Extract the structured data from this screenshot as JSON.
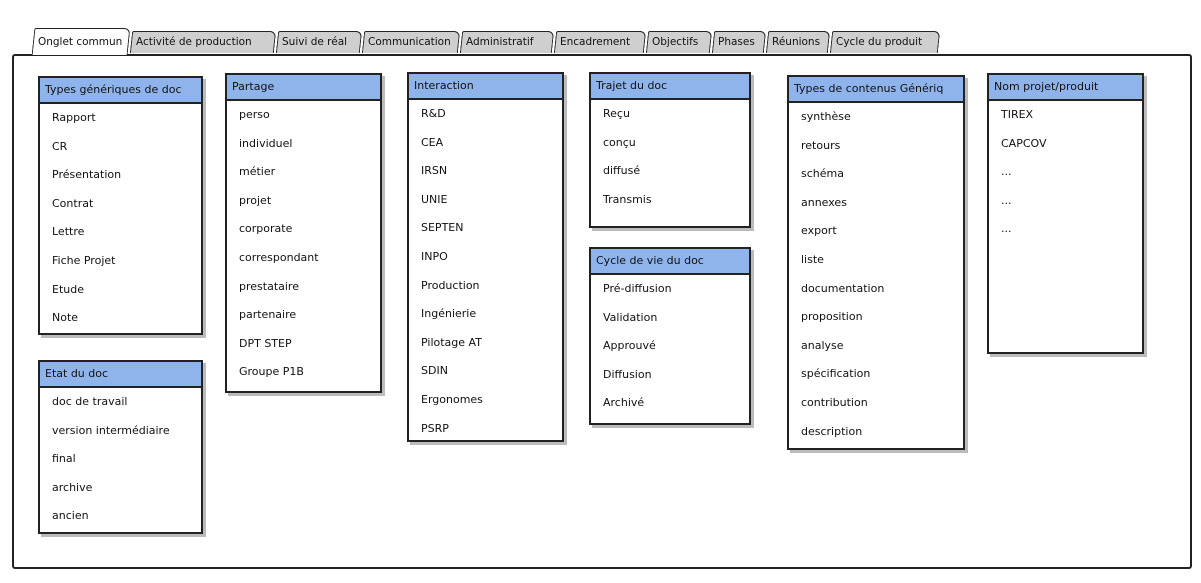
{
  "tabs": [
    {
      "label": "Onglet commun",
      "active": true
    },
    {
      "label": "Activité de production",
      "active": false
    },
    {
      "label": "Suivi de réal",
      "active": false
    },
    {
      "label": "Communication",
      "active": false
    },
    {
      "label": "Administratif",
      "active": false
    },
    {
      "label": "Encadrement",
      "active": false
    },
    {
      "label": "Objectifs",
      "active": false
    },
    {
      "label": "Phases",
      "active": false
    },
    {
      "label": "Réunions",
      "active": false
    },
    {
      "label": "Cycle du produit",
      "active": false
    }
  ],
  "lists": {
    "types_generiques": {
      "title": "Types génériques de doc",
      "items": [
        "Rapport",
        "CR",
        "Présentation",
        "Contrat",
        "Lettre",
        "Fiche Projet",
        "Etude",
        "Note"
      ]
    },
    "etat_doc": {
      "title": "Etat du doc",
      "items": [
        "doc de travail",
        "version intermédiaire",
        "final",
        "archive",
        "ancien"
      ]
    },
    "partage": {
      "title": "Partage",
      "items": [
        "perso",
        "individuel",
        "métier",
        "projet",
        "corporate",
        "correspondant",
        "prestataire",
        "partenaire",
        "DPT STEP",
        "Groupe P1B"
      ]
    },
    "interaction": {
      "title": "Interaction",
      "items": [
        "R&D",
        "CEA",
        "IRSN",
        "UNIE",
        "SEPTEN",
        "INPO",
        "Production",
        "Ingénierie",
        "Pilotage AT",
        "SDIN",
        "Ergonomes",
        "PSRP"
      ]
    },
    "trajet_doc": {
      "title": "Trajet du doc",
      "items": [
        "Reçu",
        "conçu",
        "diffusé",
        "Transmis"
      ]
    },
    "cycle_vie": {
      "title": "Cycle de vie du doc",
      "items": [
        "Pré-diffusion",
        "Validation",
        "Approuvé",
        "Diffusion",
        "Archivé"
      ]
    },
    "types_contenus": {
      "title": "Types de contenus Génériq",
      "items": [
        "synthèse",
        "retours",
        "schéma",
        "annexes",
        "export",
        "liste",
        "documentation",
        "proposition",
        "analyse",
        "spécification",
        "contribution",
        "description"
      ]
    },
    "nom_projet": {
      "title": "Nom projet/produit",
      "items": [
        "TIREX",
        "CAPCOV",
        "...",
        "...",
        "..."
      ]
    }
  }
}
